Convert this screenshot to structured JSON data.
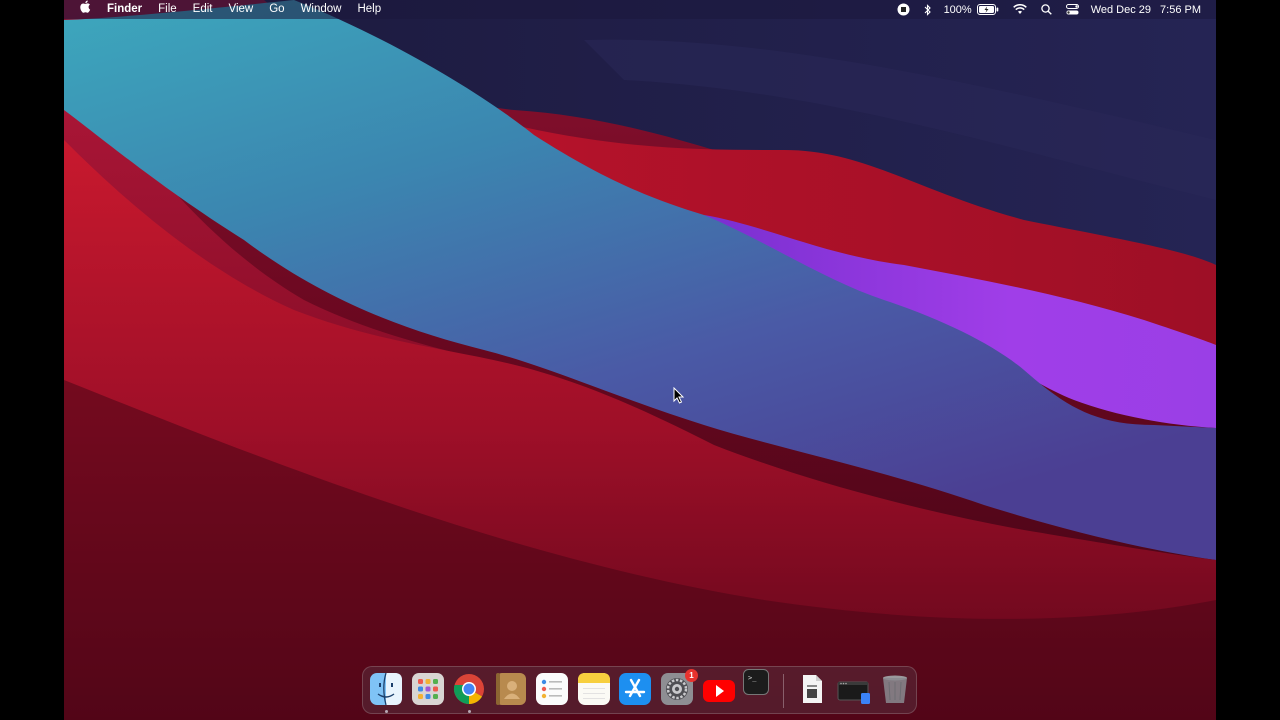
{
  "menubar": {
    "apple_icon": "apple-icon",
    "items": [
      "Finder",
      "File",
      "Edit",
      "View",
      "Go",
      "Window",
      "Help"
    ],
    "status": {
      "battery": "100%",
      "date": "Wed Dec 29",
      "time": "7:56 PM"
    }
  },
  "dock": {
    "apps": [
      {
        "name": "Finder",
        "icon": "finder-icon",
        "running": true
      },
      {
        "name": "Launchpad",
        "icon": "launchpad-icon",
        "running": false
      },
      {
        "name": "Google Chrome",
        "icon": "chrome-icon",
        "running": true
      },
      {
        "name": "Contacts",
        "icon": "contacts-icon",
        "running": false
      },
      {
        "name": "Reminders",
        "icon": "reminders-icon",
        "running": false
      },
      {
        "name": "Notes",
        "icon": "notes-icon",
        "running": false
      },
      {
        "name": "App Store",
        "icon": "app-store-icon",
        "running": false
      },
      {
        "name": "System Preferences",
        "icon": "system-preferences-icon",
        "running": false,
        "badge": "1"
      },
      {
        "name": "YouTube",
        "icon": "youtube-icon",
        "running": false
      },
      {
        "name": "Terminal",
        "icon": "terminal-icon",
        "running": false
      },
      {
        "name": "Document",
        "icon": "document-icon",
        "running": false
      },
      {
        "name": "Screen Recording",
        "icon": "screen-recording-icon",
        "running": false
      },
      {
        "name": "Trash",
        "icon": "trash-icon",
        "running": false
      }
    ],
    "terminal_prompt": ">_"
  },
  "colors": {
    "menubar_bg": "#1c183c",
    "wallpaper_red": "#c8192e",
    "wallpaper_teal": "#3aa3b8",
    "wallpaper_purple": "#9b3be8",
    "wallpaper_navy": "#1a1a3e"
  }
}
